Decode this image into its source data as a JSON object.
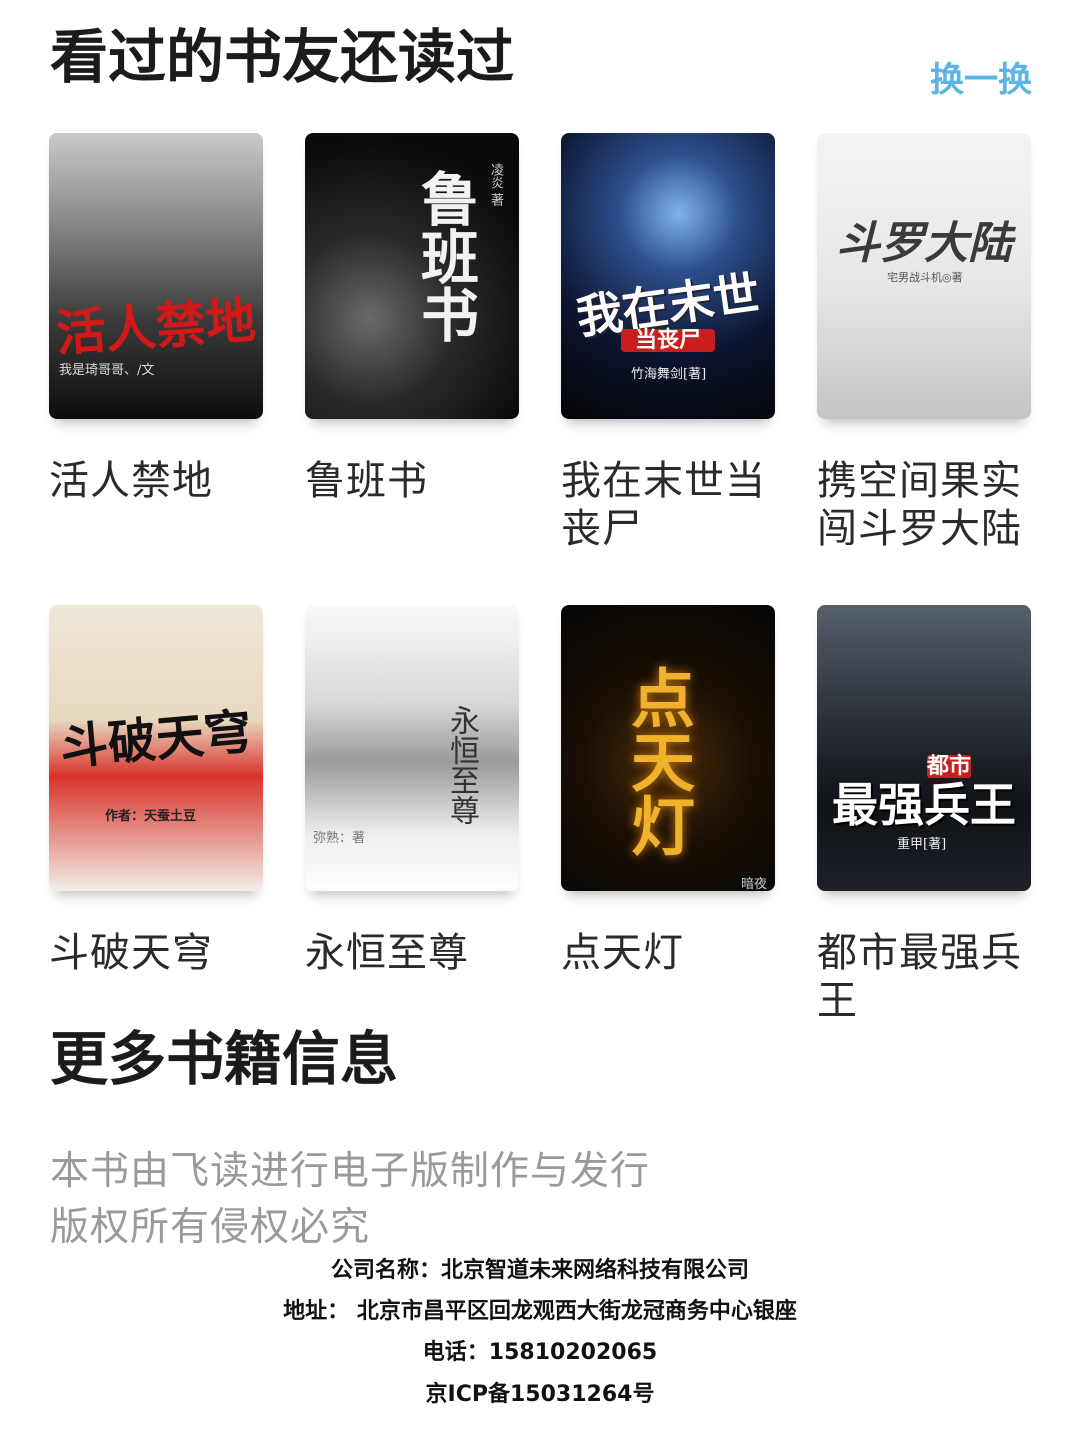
{
  "section1": {
    "title": "看过的书友还读过",
    "refresh_label": "换一换"
  },
  "books": [
    {
      "title": "活人禁地",
      "cover_title": "活人禁地",
      "cover_author": "我是琦哥哥、/文"
    },
    {
      "title": "鲁班书",
      "cover_title": "鲁班书",
      "cover_author": "凌炎 著"
    },
    {
      "title": "我在末世当丧尸",
      "cover_title": "我在末世",
      "cover_title2": "当丧尸",
      "cover_author": "竹海舞剑[著]"
    },
    {
      "title": "携空间果实闯斗罗大陆",
      "cover_title": "斗罗大陆",
      "cover_author": "宅男战斗机◎著"
    },
    {
      "title": "斗破天穹",
      "cover_title": "斗破天穹",
      "cover_author": "作者：天蚕土豆"
    },
    {
      "title": "永恒至尊",
      "cover_title": "永恒至尊",
      "cover_author": "弥熟：著"
    },
    {
      "title": "点天灯",
      "cover_title": "点天灯",
      "cover_author": "暗夜"
    },
    {
      "title": "都市最强兵王",
      "cover_title": "最强兵王",
      "cover_title2": "都市",
      "cover_author": "重甲[著]"
    }
  ],
  "section2": {
    "title": "更多书籍信息"
  },
  "description": {
    "line1": "本书由飞读进行电子版制作与发行",
    "line2": "版权所有侵权必究"
  },
  "footer": {
    "company": "公司名称：北京智道未来网络科技有限公司",
    "address": "地址： 北京市昌平区回龙观西大街龙冠商务中心银座",
    "phone": "电话：15810202065",
    "icp": "京ICP备15031264号"
  },
  "colors": {
    "accent": "#5ab4e6",
    "muted_text": "#9a9a9a"
  }
}
